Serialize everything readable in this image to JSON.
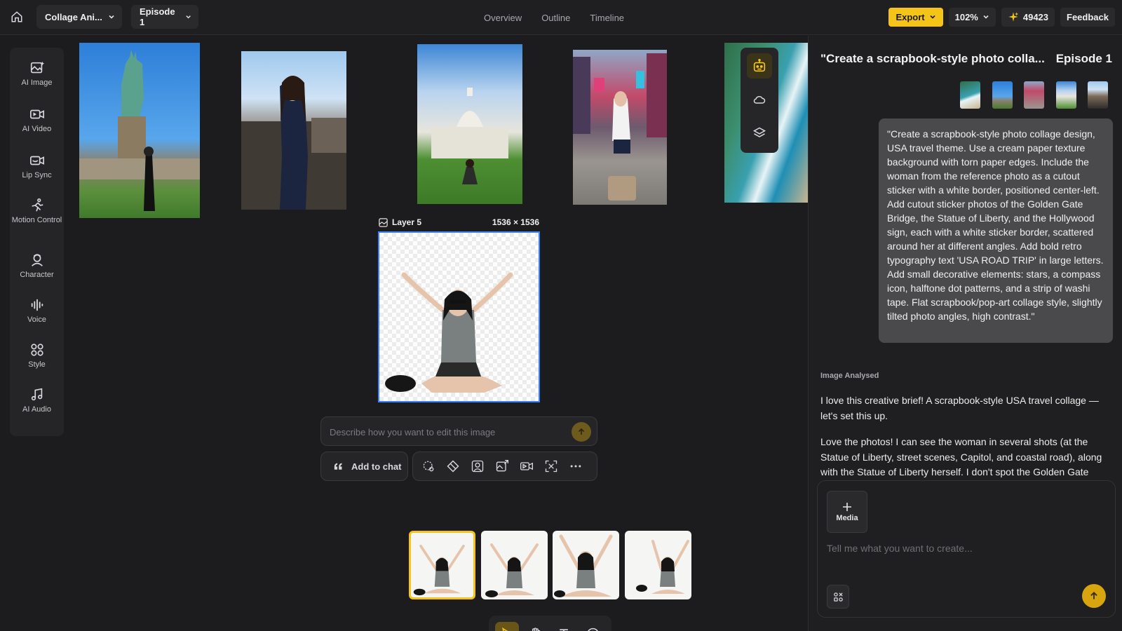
{
  "header": {
    "project_name": "Collage Ani...",
    "episode_label": "Episode 1",
    "tabs": [
      "Overview",
      "Outline",
      "Timeline"
    ],
    "export_label": "Export",
    "zoom": "102%",
    "credits": "49423",
    "feedback_label": "Feedback"
  },
  "left_rail": {
    "items": [
      {
        "label": "AI Image",
        "icon": "ai-image-icon"
      },
      {
        "label": "AI Video",
        "icon": "ai-video-icon"
      },
      {
        "label": "Lip Sync",
        "icon": "lip-sync-icon"
      },
      {
        "label": "Motion Control",
        "icon": "motion-control-icon"
      },
      {
        "label": "Character",
        "icon": "character-icon"
      },
      {
        "label": "Voice",
        "icon": "voice-icon"
      },
      {
        "label": "Style",
        "icon": "style-icon"
      },
      {
        "label": "AI Audio",
        "icon": "ai-audio-icon"
      }
    ]
  },
  "canvas": {
    "layer_name": "Layer 5",
    "layer_size": "1536 × 1536",
    "edit_placeholder": "Describe how you want to edit this image",
    "add_to_chat_label": "Add to chat",
    "accent_color": "#f5c419",
    "selection_color": "#3b82f6"
  },
  "chat": {
    "title": "\"Create a scrapbook-style photo colla...",
    "episode": "Episode 1",
    "user_prompt": "\"Create a scrapbook-style photo collage design, USA travel theme. Use a cream paper texture background with torn paper edges. Include the woman from the reference photo as a cutout sticker with a white border, positioned center-left. Add cutout sticker photos of the Golden Gate Bridge, the Statue of Liberty, and the Hollywood sign, each with a white sticker border, scattered around her at different angles. Add bold retro typography text 'USA ROAD TRIP' in large letters. Add small decorative elements: stars, a compass icon, halftone dot patterns, and a strip of washi tape. Flat scrapbook/pop-art collage style, slightly tilted photo angles, high contrast.\"",
    "status_label": "Image Analysed",
    "assistant_paragraphs": [
      "I love this creative brief! A scrapbook-style USA travel collage — let's set this up.",
      "Love the photos! I can see the woman in several shots (at the Statue of Liberty, street scenes, Capitol, and coastal road), along with the Statue of Liberty herself. I don't spot the Golden Gate"
    ],
    "media_label": "Media",
    "composer_placeholder": "Tell me what you want to create..."
  }
}
